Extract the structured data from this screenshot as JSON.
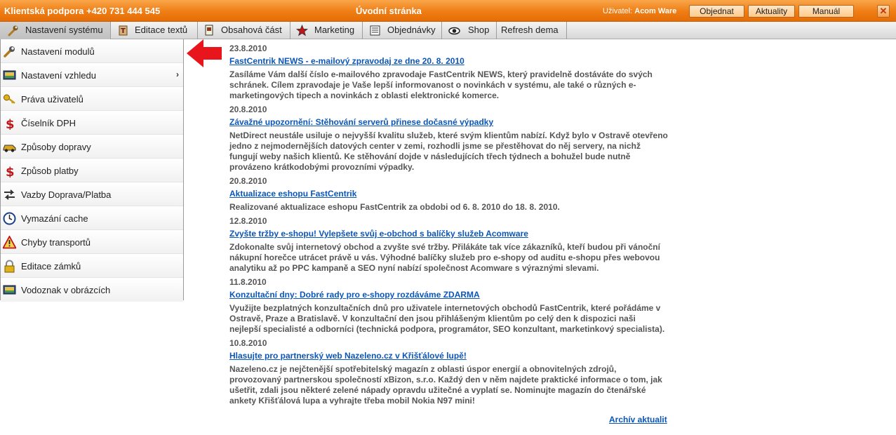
{
  "topbar": {
    "support": "Klientská podpora +420 731 444 545",
    "page_title": "Úvodní stránka",
    "user_label": "Uživatel:",
    "user_name": "Acom Ware",
    "buttons": {
      "order": "Objednat",
      "news": "Aktuality",
      "manual": "Manuál"
    },
    "close": "✕"
  },
  "menu": {
    "items": [
      {
        "label": "Nastavení systému",
        "icon": "wrench-icon"
      },
      {
        "label": "Editace textů",
        "icon": "text-edit-icon"
      },
      {
        "label": "Obsahová část",
        "icon": "content-icon"
      },
      {
        "label": "Marketing",
        "icon": "star-icon"
      },
      {
        "label": "Objednávky",
        "icon": "orders-icon"
      },
      {
        "label": "Shop",
        "icon": "eye-icon"
      },
      {
        "label": "Refresh dema",
        "icon": ""
      }
    ]
  },
  "dropdown": {
    "items": [
      {
        "label": "Nastavení modulů",
        "icon": "wrench-icon"
      },
      {
        "label": "Nastavení vzhledu",
        "icon": "display-icon",
        "submenu": "›"
      },
      {
        "label": "Práva uživatelů",
        "icon": "key-icon"
      },
      {
        "label": "Číselník DPH",
        "icon": "dollar-icon"
      },
      {
        "label": "Způsoby dopravy",
        "icon": "car-icon"
      },
      {
        "label": "Způsob platby",
        "icon": "dollar-icon"
      },
      {
        "label": "Vazby Doprava/Platba",
        "icon": "arrows-icon"
      },
      {
        "label": "Vymazání cache",
        "icon": "clock-icon"
      },
      {
        "label": "Chyby transportů",
        "icon": "warning-icon"
      },
      {
        "label": "Editace zámků",
        "icon": "lock-icon"
      },
      {
        "label": "Vodoznak v obrázcích",
        "icon": "picture-icon"
      }
    ]
  },
  "news": [
    {
      "date": "23.8.2010",
      "title": "FastCentrik NEWS - e-mailový zpravodaj ze dne 20. 8. 2010",
      "text": "Zasíláme Vám další číslo e-mailového zpravodaje FastCentrik NEWS, který pravidelně dostáváte do svých schránek. Cílem zpravodaje je Vaše lepší informovanost o novinkách v systému, ale také o různých e-marketingových tipech a novinkách z oblasti elektronické komerce."
    },
    {
      "date": "20.8.2010",
      "title": "Závažné upozornění: Stěhování serverů přinese dočasné výpadky",
      "text": "NetDirect neustále usiluje o nejvyšší kvalitu služeb, které svým klientům nabízí. Když bylo v Ostravě otevřeno jedno z nejmodernějších datových center v zemi, rozhodli jsme se přestěhovat do něj servery, na nichž fungují weby našich klientů. Ke stěhování dojde v následujících třech týdnech a bohužel bude nutně provázeno krátkodobými provozními výpadky."
    },
    {
      "date": "20.8.2010",
      "title": "Aktualizace eshopu FastCentrik",
      "text": "Realizované aktualizace eshopu FastCentrik za obdobi od 6. 8. 2010 do 18. 8. 2010."
    },
    {
      "date": "12.8.2010",
      "title": "Zvyšte tržby e-shopu! Vylepšete svůj e-obchod s balíčky služeb Acomware",
      "text": "Zdokonalte svůj internetový obchod a zvyšte své tržby. Přilákáte tak více zákazníků, kteří budou při vánoční nákupní horečce utrácet právě u vás. Výhodné balíčky služeb pro e-shopy od auditu e-shopu přes webovou analytiku až po PPC kampaně a SEO nyní nabízí společnost Acomware s výraznými slevami."
    },
    {
      "date": "11.8.2010",
      "title": "Konzultační dny: Dobré rady pro e-shopy rozdáváme ZDARMA",
      "text": "Využijte bezplatných konzultačních dnů pro uživatele internetových obchodů FastCentrik, které pořádáme v Ostravě, Praze a Bratislavě. V konzultační den jsou přihlášeným klientům po celý den k dispozici naši nejlepší specialisté a odborníci (technická podpora, programátor, SEO konzultant, marketinkový specialista)."
    },
    {
      "date": "10.8.2010",
      "title": "Hlasujte pro partnerský web Nazeleno.cz v Křišťálové lupě!",
      "text": "Nazeleno.cz je nejčtenější spotřebitelský magazín z oblasti úspor energií a obnovitelných zdrojů, provozovaný partnerskou společností xBizon, s.r.o. Každý den v něm najdete praktické informace o tom, jak ušetřit, zdali jsou některé zelené nápady opravdu užitečné a vyplatí se. Nominujte magazín do čtenářské ankety Křišťálová lupa a vyhrajte třeba mobil Nokia N97 mini!"
    }
  ],
  "archive_link": "Archív aktualit"
}
